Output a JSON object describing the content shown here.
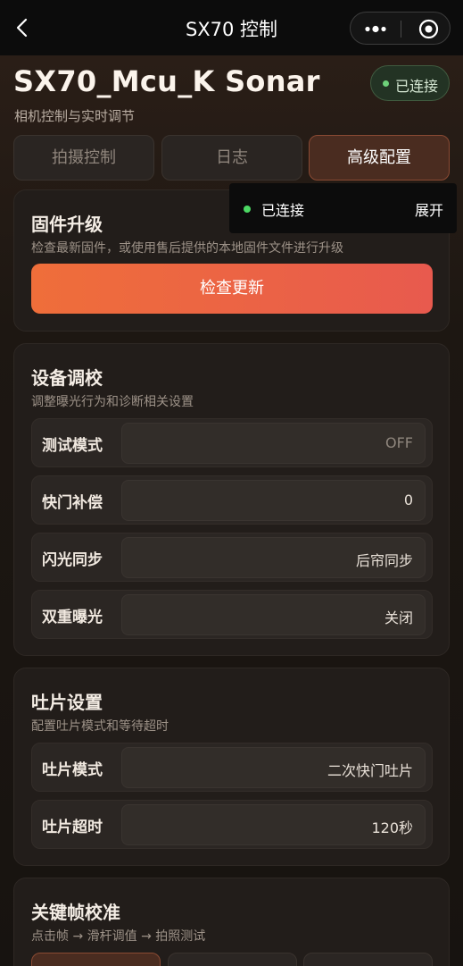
{
  "navbar": {
    "title": "SX70 控制",
    "back_icon": "chevron-left-icon",
    "more_icon": "more-dots-icon",
    "target_icon": "target-icon"
  },
  "header": {
    "title": "SX70_Mcu_K Sonar",
    "subtitle": "相机控制与实时调节",
    "status": "已连接",
    "status_color": "#6ed17a"
  },
  "tabs": [
    {
      "label": "拍摄控制",
      "active": false
    },
    {
      "label": "日志",
      "active": false
    },
    {
      "label": "高级配置",
      "active": true
    }
  ],
  "toast": {
    "text": "已连接",
    "action": "展开"
  },
  "firmware": {
    "title": "固件升级",
    "desc": "检查最新固件，或使用售后提供的本地固件文件进行升级",
    "button": "检查更新"
  },
  "calibration": {
    "title": "设备调校",
    "desc": "调整曝光行为和诊断相关设置",
    "rows": [
      {
        "label": "测试模式",
        "value": "OFF"
      },
      {
        "label": "快门补偿",
        "value": "0"
      },
      {
        "label": "闪光同步",
        "value": "后帘同步"
      },
      {
        "label": "双重曝光",
        "value": "关闭"
      }
    ]
  },
  "eject": {
    "title": "吐片设置",
    "desc": "配置吐片模式和等待超时",
    "rows": [
      {
        "label": "吐片模式",
        "value": "二次快门吐片"
      },
      {
        "label": "吐片超时",
        "value": "120秒"
      }
    ]
  },
  "keyframe": {
    "title": "关键帧校准",
    "desc": "点击帧 → 滑杆调值 → 拍照测试"
  },
  "colors": {
    "accent": "#ef6e3a",
    "background": "#181411"
  }
}
